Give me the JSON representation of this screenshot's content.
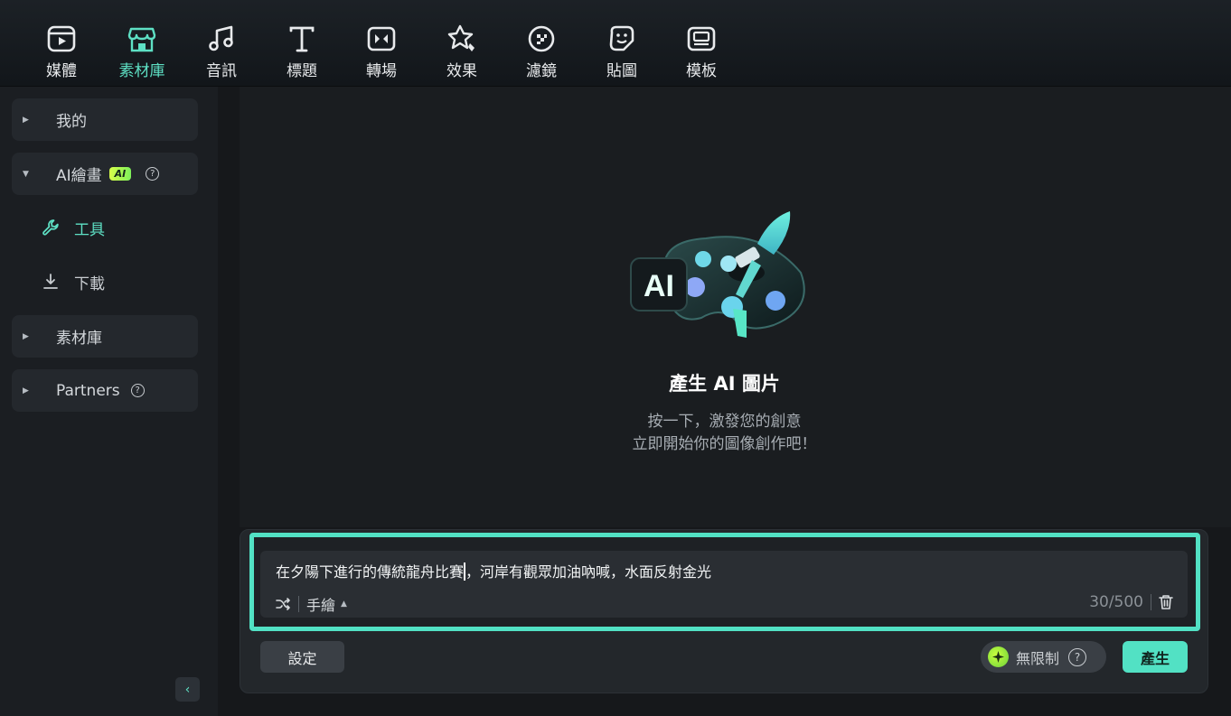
{
  "toolbar": {
    "items": [
      {
        "label": "媒體",
        "icon": "media-icon"
      },
      {
        "label": "素材庫",
        "icon": "store-icon",
        "active": true
      },
      {
        "label": "音訊",
        "icon": "music-note-icon"
      },
      {
        "label": "標題",
        "icon": "text-t-icon"
      },
      {
        "label": "轉場",
        "icon": "transition-icon"
      },
      {
        "label": "效果",
        "icon": "effects-icon"
      },
      {
        "label": "濾鏡",
        "icon": "filter-icon"
      },
      {
        "label": "貼圖",
        "icon": "sticker-icon"
      },
      {
        "label": "模板",
        "icon": "template-icon"
      }
    ]
  },
  "sidebar": {
    "my": "我的",
    "ai_drawing": "AI繪畫",
    "ai_badge": "AI",
    "help_glyph": "?",
    "tools": "工具",
    "download": "下載",
    "library": "素材庫",
    "partners": "Partners",
    "collapse_glyph": "‹"
  },
  "hero": {
    "illustration_text": "AI",
    "title": "產生 AI 圖片",
    "subtitle_line1": "按一下，激發您的創意",
    "subtitle_line2": "立即開始你的圖像創作吧！"
  },
  "prompt": {
    "text_before_cursor": "在夕陽下進行的傳統龍舟比賽",
    "text_after_cursor": "，河岸有觀眾加油吶喊，水面反射金光",
    "style_label": "手繪",
    "style_caret": "▲",
    "counter": "30/500"
  },
  "actions": {
    "settings": "設定",
    "unlimited": "無限制",
    "help_glyph": "?",
    "generate": "產生"
  },
  "colors": {
    "accent": "#52e1c4",
    "badge": "#c8ff3e"
  }
}
